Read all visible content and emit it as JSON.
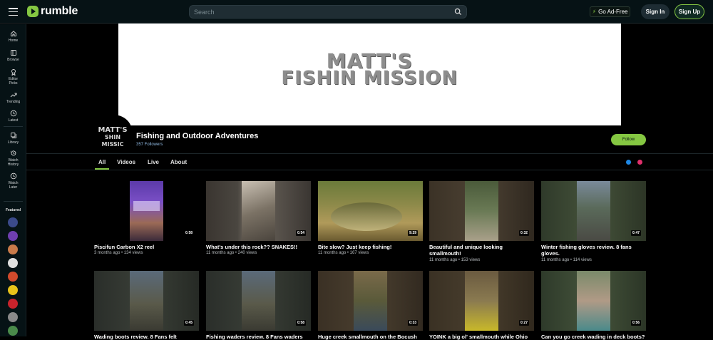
{
  "header": {
    "logo_text": "rumble",
    "search_placeholder": "Search",
    "ad_free_label": "Go Ad-Free",
    "sign_in_label": "Sign In",
    "sign_up_label": "Sign Up",
    "accent_color": "#85c742"
  },
  "sidebar": {
    "items": [
      {
        "label": "Home",
        "icon": "home-icon"
      },
      {
        "label": "Browse",
        "icon": "browse-icon"
      },
      {
        "label": "Editor Picks",
        "icon": "ribbon-icon"
      },
      {
        "label": "Trending",
        "icon": "trending-icon"
      },
      {
        "label": "Latest",
        "icon": "clock-icon"
      },
      {
        "label": "Library",
        "icon": "library-icon"
      },
      {
        "label": "Watch History",
        "icon": "history-icon"
      },
      {
        "label": "Watch Later",
        "icon": "watch-later-icon"
      }
    ],
    "featured_title": "Featured",
    "featured_colors": [
      "#3b4a8a",
      "#6f3fb0",
      "#c97a4a",
      "#e0e0e0",
      "#d24a2c",
      "#e8c21a",
      "#c8232c",
      "#8a8a8a",
      "#4a8a4a"
    ]
  },
  "channel": {
    "banner_line1": "MATT'S",
    "banner_line2": "FISHIN MISSION",
    "avatar_line1": "MATT'S",
    "avatar_line2": "SHIN MISSIC",
    "name": "Fishing and Outdoor Adventures",
    "followers": "357 Followers",
    "follow_label": "Follow"
  },
  "tabs": [
    "All",
    "Videos",
    "Live",
    "About"
  ],
  "videos": [
    {
      "title_line1": "Piscifun Carbon X2 reel",
      "title_line2": "",
      "meta": "3 months ago • 134 views",
      "duration": "0:58"
    },
    {
      "title_line1": "What's under this rock?? SNAKES!!",
      "title_line2": "",
      "meta": "11 months ago • 240 views",
      "duration": "0:54"
    },
    {
      "title_line1": "Bite slow? Just keep fishing!",
      "title_line2": "",
      "meta": "11 months ago • 167 views",
      "duration": "9:29"
    },
    {
      "title_line1": "Beautiful and unique looking",
      "title_line2": "smallmouth!",
      "meta": "11 months ago • 153 views",
      "duration": "0:32"
    },
    {
      "title_line1": "Winter fishing gloves review. 8 fans",
      "title_line2": "gloves.",
      "meta": "11 months ago • 114 views",
      "duration": "0:47"
    },
    {
      "title_line1": "Wading boots review. 8 Fans felt",
      "title_line2": "",
      "meta": "",
      "duration": "0:45"
    },
    {
      "title_line1": "Fishing waders review. 8 Fans waders",
      "title_line2": "",
      "meta": "",
      "duration": "0:58"
    },
    {
      "title_line1": "Huge creek smallmouth on the Bocush",
      "title_line2": "",
      "meta": "",
      "duration": "0:33"
    },
    {
      "title_line1": "YOINK a big ol' smallmouth while Ohio",
      "title_line2": "",
      "meta": "",
      "duration": "0:27"
    },
    {
      "title_line1": "Can you go creek wading in deck boots?",
      "title_line2": "",
      "meta": "",
      "duration": "0:56"
    }
  ]
}
